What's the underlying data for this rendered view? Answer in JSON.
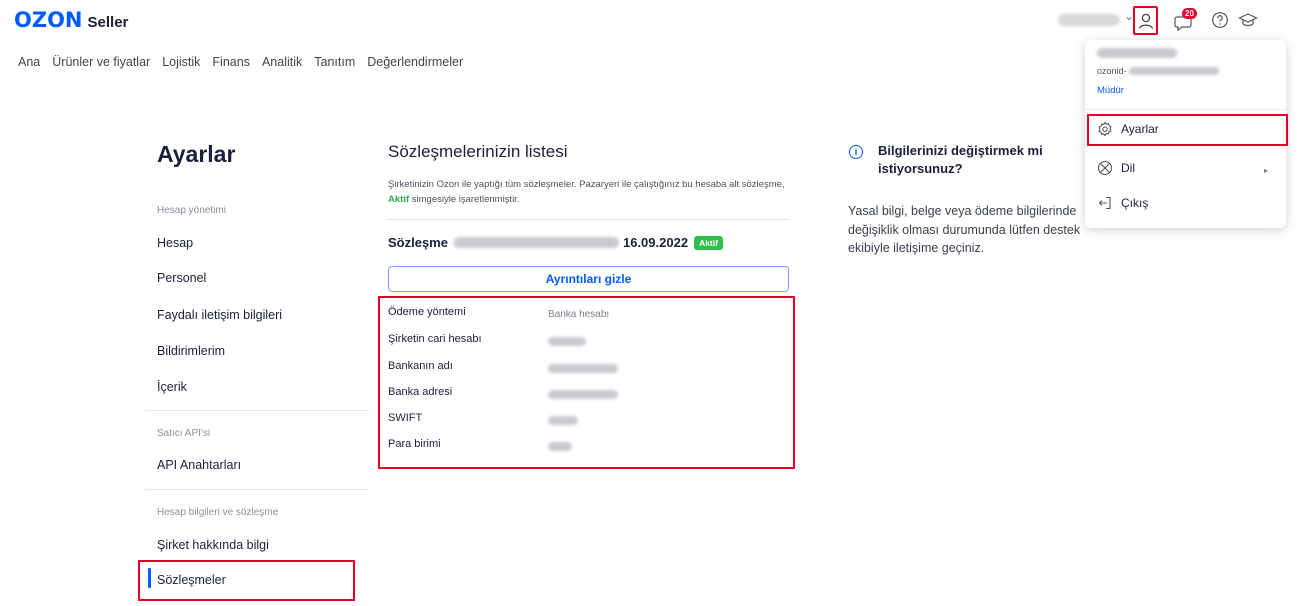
{
  "header": {
    "logo_brand": "OZON",
    "logo_product": "Seller",
    "notifications_count": "20"
  },
  "nav": {
    "items": [
      "Ana",
      "Ürünler ve fiyatlar",
      "Lojistik",
      "Finans",
      "Analitik",
      "Tanıtım",
      "Değerlendirmeler"
    ]
  },
  "sidebar": {
    "title": "Ayarlar",
    "section_account": "Hesap yönetimi",
    "items_account": [
      "Hesap",
      "Personel",
      "Faydalı iletişim bilgileri",
      "Bildirimlerim",
      "İçerik"
    ],
    "section_api": "Satıcı API'si",
    "items_api": [
      "API Anahtarları"
    ],
    "section_company": "Hesap bilgileri ve sözleşme",
    "items_company": [
      "Şirket hakkında bilgi",
      "Sözleşmeler"
    ]
  },
  "contracts": {
    "title": "Sözleşmelerinizin listesi",
    "description_part1": "Şirketinizin Ozon ile yaptığı tüm sözleşmeler. Pazaryeri ile çalıştığınız bu hesaba alt sözleşme,",
    "description_aktif": "Aktif",
    "description_part2": "simgesiyle işaretlenmiştir.",
    "contract_prefix": "Sözleşme",
    "contract_date": "16.09.2022",
    "contract_status": "Aktif",
    "toggle_label": "Ayrıntıları gizle",
    "details": [
      {
        "label": "Ödeme yöntemi",
        "value": "Banka hesabı"
      },
      {
        "label": "Şirketin cari hesabı",
        "value": ""
      },
      {
        "label": "Bankanın adı",
        "value": ""
      },
      {
        "label": "Banka adresi",
        "value": ""
      },
      {
        "label": "SWIFT",
        "value": ""
      },
      {
        "label": "Para birimi",
        "value": ""
      }
    ]
  },
  "info": {
    "title": "Bilgilerinizi değiştirmek mi istiyorsunuz?",
    "text": "Yasal bilgi, belge veya ödeme bilgilerinde değişiklik olması durumunda lütfen destek ekibiyle iletişime geçiniz."
  },
  "user_menu": {
    "id_prefix": "ozonid-",
    "role": "Müdür",
    "items": [
      "Ayarlar",
      "Dil",
      "Çıkış"
    ]
  },
  "colors": {
    "accent": "#005bff",
    "highlight": "#e4002b",
    "active": "#2fbf4f"
  }
}
